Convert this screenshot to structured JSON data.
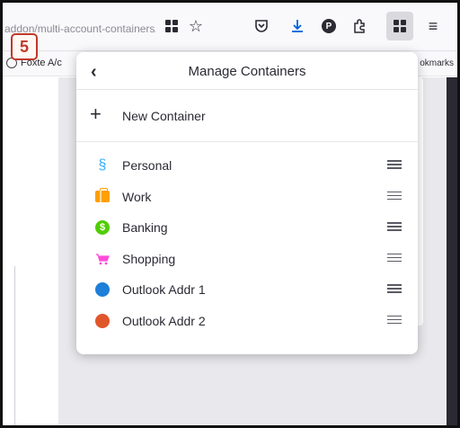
{
  "browser": {
    "url": "addon/multi-account-containers/",
    "bookmarks_left": "Foxte A/c",
    "bookmarks_right": "okmarks"
  },
  "step": {
    "number": "5"
  },
  "panel": {
    "title": "Manage Containers",
    "new_container_label": "New Container",
    "containers": [
      {
        "name": "Personal",
        "icon": "fingerprint-icon",
        "color": "#37adff"
      },
      {
        "name": "Work",
        "icon": "briefcase-icon",
        "color": "#ff9f00"
      },
      {
        "name": "Banking",
        "icon": "dollar-icon",
        "color": "#51cd00"
      },
      {
        "name": "Shopping",
        "icon": "cart-icon",
        "color": "#ff4bda"
      },
      {
        "name": "Outlook Addr 1",
        "icon": "circle-icon",
        "color": "#1e7fd9"
      },
      {
        "name": "Outlook Addr 2",
        "icon": "circle-icon",
        "color": "#e0562b"
      }
    ]
  }
}
